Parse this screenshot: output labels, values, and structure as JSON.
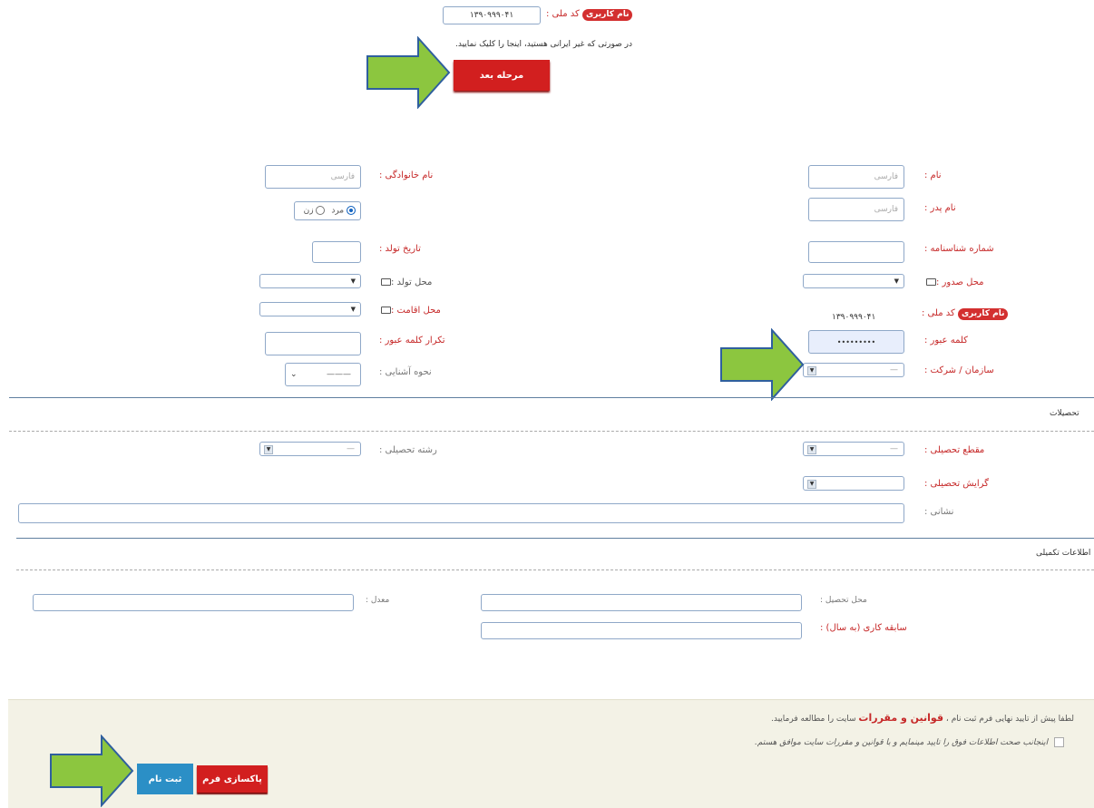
{
  "top": {
    "username_badge": "نام کاربری",
    "national_code_label": "کد ملی :",
    "national_code_value": "۱۳۹۰۹۹۹۰۴۱",
    "non_iranian_text": "در صورتی که غیر ایرانی هستید، اینجا را کلیک نمایید.",
    "next_button": "مرحله بعد"
  },
  "form": {
    "first_name_label": "نام :",
    "first_name_placeholder": "فارسی",
    "last_name_label": "نام خانوادگی :",
    "last_name_placeholder": "فارسی",
    "father_name_label": "نام پدر :",
    "father_name_placeholder": "فارسی",
    "gender_male": "مرد",
    "gender_female": "زن",
    "id_number_label": "شماره شناسنامه :",
    "birth_date_label": "تاریخ تولد :",
    "issue_place_label": "محل صدور :",
    "birth_place_label": "محل تولد :",
    "national_code_badge": "نام کاربری",
    "national_code_label": "کد ملی :",
    "national_code_value": "۱۳۹۰۹۹۹۰۴۱",
    "residence_label": "محل اقامت :",
    "password_label": "کلمه عبور :",
    "password_value": "•••••••••",
    "password_repeat_label": "تکرار کلمه عبور :",
    "organization_label": "سازمان / شرکت :",
    "acquaintance_label": "نحوه آشنایی :",
    "dash": "—",
    "long_dash": "———"
  },
  "education": {
    "section_title": "تحصیلات",
    "degree_label": "مقطع تحصیلی :",
    "field_label": "رشته تحصیلی :",
    "orientation_label": "گرایش تحصیلی :",
    "address_label": "نشانی :"
  },
  "extra": {
    "section_title": "اطلاعات تکمیلی",
    "study_place_label": "محل تحصیل :",
    "gpa_label": "معدل :",
    "experience_label": "سابقه کاری (به سال) :"
  },
  "footer": {
    "terms_prefix": "لطفا پیش از تایید نهایی فرم ثبت نام ،",
    "terms_link": "قوانین و مقررات",
    "terms_suffix": "سایت را مطالعه فرمایید.",
    "agree_text": "اینجانب صحت اطلاعات فوق را تایید مینمایم و با قوانین و مقررات سایت موافق هستم.",
    "clear_button": "پاکسازی فرم",
    "submit_button": "ثبت نام"
  },
  "colors": {
    "red_button": "#d21f1f",
    "blue_button": "#2b8fc6",
    "arrow_green": "#8cc63f",
    "footer_bg": "#f3f2e6"
  }
}
